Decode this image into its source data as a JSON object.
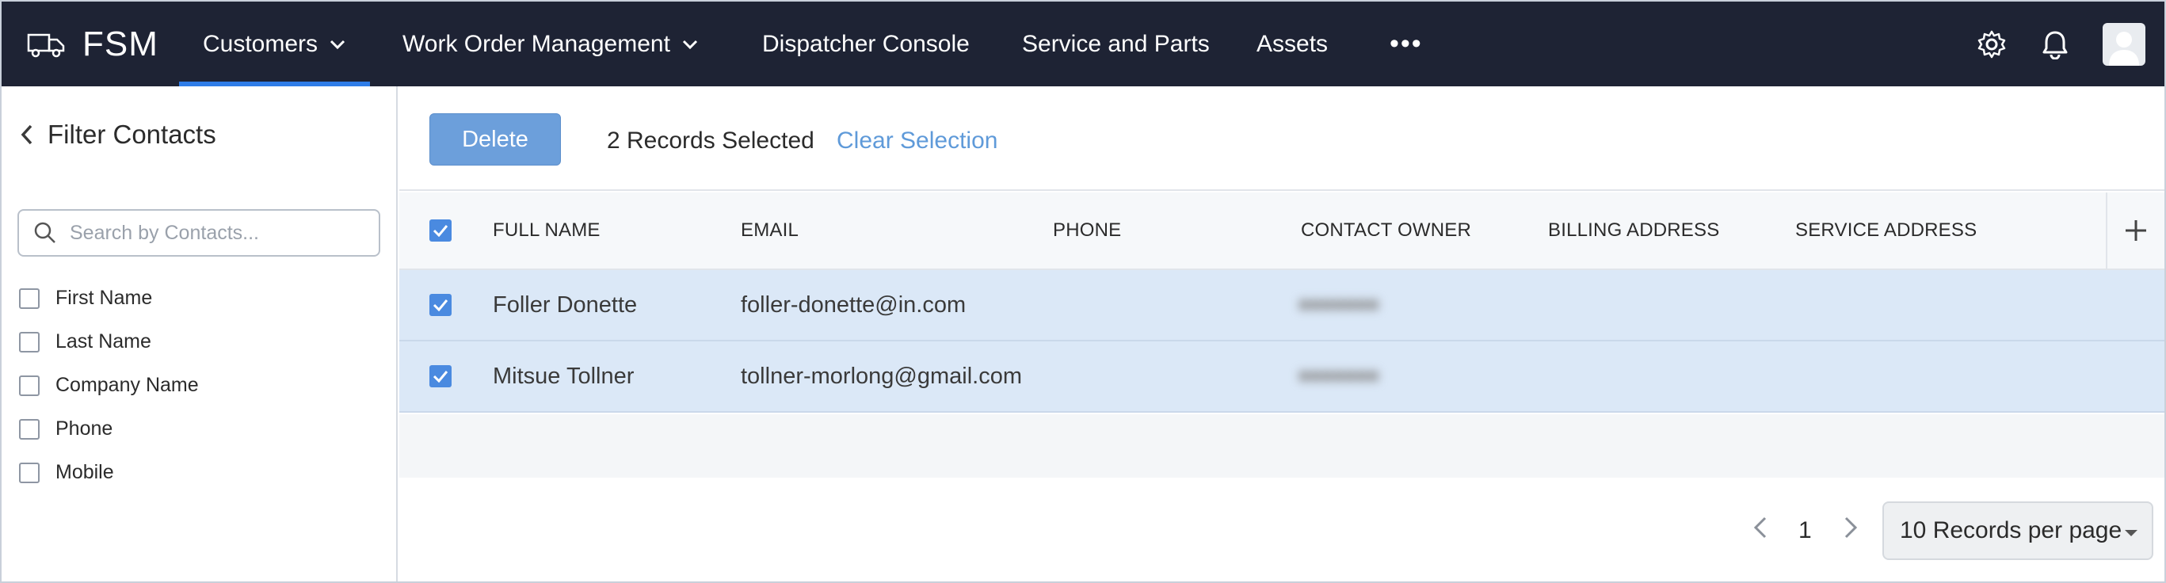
{
  "app": {
    "brand": "FSM"
  },
  "nav": {
    "items": [
      {
        "label": "Customers",
        "has_dropdown": true,
        "active": true
      },
      {
        "label": "Work Order Management",
        "has_dropdown": true
      },
      {
        "label": "Dispatcher Console"
      },
      {
        "label": "Service and Parts"
      },
      {
        "label": "Assets"
      }
    ],
    "more": "•••",
    "icons": [
      "gear-icon",
      "bell-icon",
      "avatar"
    ],
    "active_underline_color": "#2f7de8",
    "background": "#1e2334"
  },
  "sidebar": {
    "title": "Filter Contacts",
    "search_placeholder": "Search by Contacts...",
    "fields": [
      "First Name",
      "Last Name",
      "Company Name",
      "Phone",
      "Mobile"
    ]
  },
  "actionbar": {
    "delete_label": "Delete",
    "selected_text": "2 Records Selected",
    "clear_label": "Clear Selection"
  },
  "table": {
    "columns": [
      "FULL NAME",
      "EMAIL",
      "PHONE",
      "CONTACT OWNER",
      "BILLING ADDRESS",
      "SERVICE ADDRESS"
    ],
    "rows": [
      {
        "full_name": "Foller Donette",
        "email": "foller-donette@in.com",
        "phone": "",
        "contact_owner": "redacted",
        "billing_address": "",
        "service_address": "",
        "selected": true
      },
      {
        "full_name": "Mitsue Tollner",
        "email": "tollner-morlong@gmail.com",
        "phone": "",
        "contact_owner": "redacted",
        "billing_address": "",
        "service_address": "",
        "selected": true
      }
    ],
    "selected_row_color": "#dbe8f7"
  },
  "pagination": {
    "current_page": "1",
    "per_page_label": "10 Records per page"
  }
}
